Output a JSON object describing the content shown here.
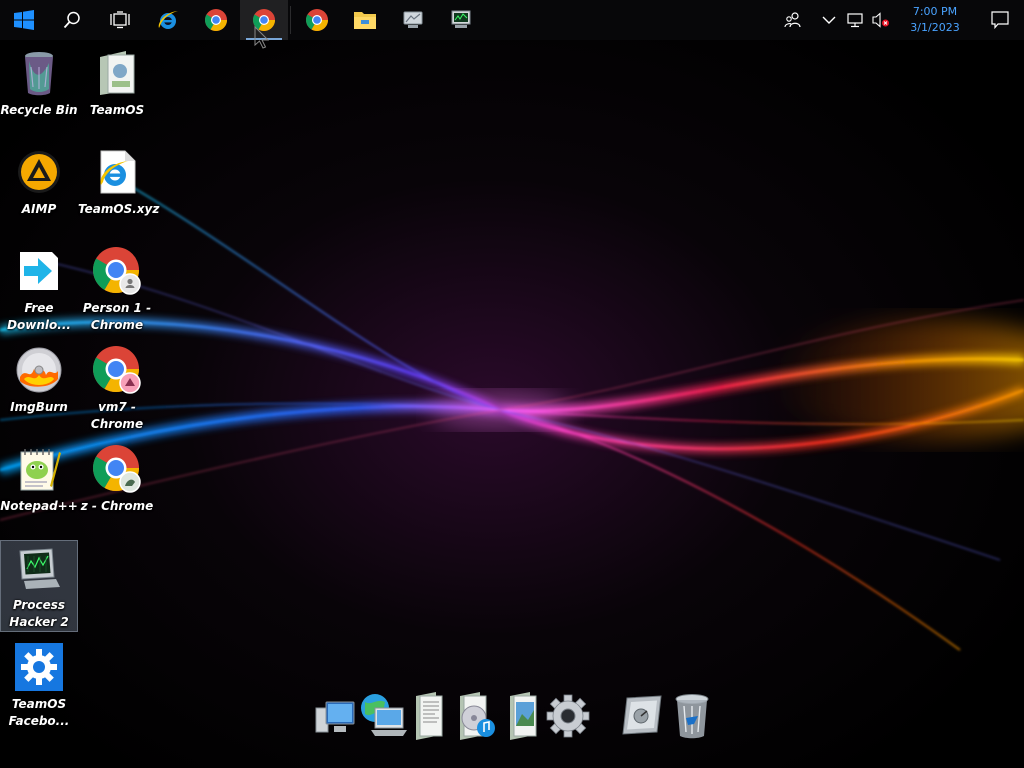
{
  "taskbar": {
    "start": {
      "icon": "windows-logo-icon"
    },
    "search": {
      "icon": "search-icon"
    },
    "task_view": {
      "icon": "task-view-icon"
    },
    "pinned": [
      {
        "name": "internet-explorer",
        "icon": "internet-explorer-icon"
      },
      {
        "name": "chrome-1",
        "icon": "chrome-icon"
      },
      {
        "name": "chrome-2",
        "icon": "chrome-icon",
        "active": true
      },
      {
        "name": "chrome-3",
        "icon": "chrome-icon"
      },
      {
        "name": "file-explorer",
        "icon": "folder-icon"
      },
      {
        "name": "app-monitor",
        "icon": "monitor-icon"
      },
      {
        "name": "process-hacker",
        "icon": "process-monitor-icon"
      }
    ],
    "tray": {
      "people_icon": "people-icon",
      "overflow_icon": "chevron-up-icon",
      "network_icon": "network-icon",
      "volume_icon": "volume-muted-icon",
      "time": "7:00 PM",
      "date": "3/1/2023",
      "action_center_icon": "notification-icon"
    }
  },
  "desktop": {
    "icons": [
      {
        "label": "Recycle Bin",
        "icon": "recycle-bin-icon"
      },
      {
        "label": "TeamOS",
        "icon": "folder-icon"
      },
      {
        "label": "AIMP",
        "icon": "aimp-icon"
      },
      {
        "label": "TeamOS.xyz",
        "icon": "internet-explorer-icon"
      },
      {
        "label": "Free\nDownlo...",
        "icon": "download-arrow-icon"
      },
      {
        "label": "Person 1 -\nChrome",
        "icon": "chrome-icon"
      },
      {
        "label": "ImgBurn",
        "icon": "disc-icon"
      },
      {
        "label": "vm7 -\nChrome",
        "icon": "chrome-icon"
      },
      {
        "label": "Notepad++",
        "icon": "notepad-icon"
      },
      {
        "label": "z - Chrome",
        "icon": "chrome-icon"
      },
      {
        "label": "Process\nHacker 2",
        "icon": "process-monitor-icon",
        "selected": true
      },
      {
        "label": "TeamOS\nFacebo...",
        "icon": "gear-icon"
      }
    ]
  },
  "dock": {
    "items": [
      {
        "name": "computer",
        "icon": "computer-icon"
      },
      {
        "name": "network",
        "icon": "network-globe-icon"
      },
      {
        "name": "documents",
        "icon": "documents-icon"
      },
      {
        "name": "music",
        "icon": "music-icon"
      },
      {
        "name": "pictures",
        "icon": "pictures-icon"
      },
      {
        "name": "settings",
        "icon": "gear-icon"
      },
      {
        "name": "control-panel",
        "icon": "control-panel-icon"
      },
      {
        "name": "trash",
        "icon": "trash-icon"
      }
    ]
  },
  "colors": {
    "clock_text": "#4aa3ff",
    "windows_blue": "#1e90ff"
  }
}
